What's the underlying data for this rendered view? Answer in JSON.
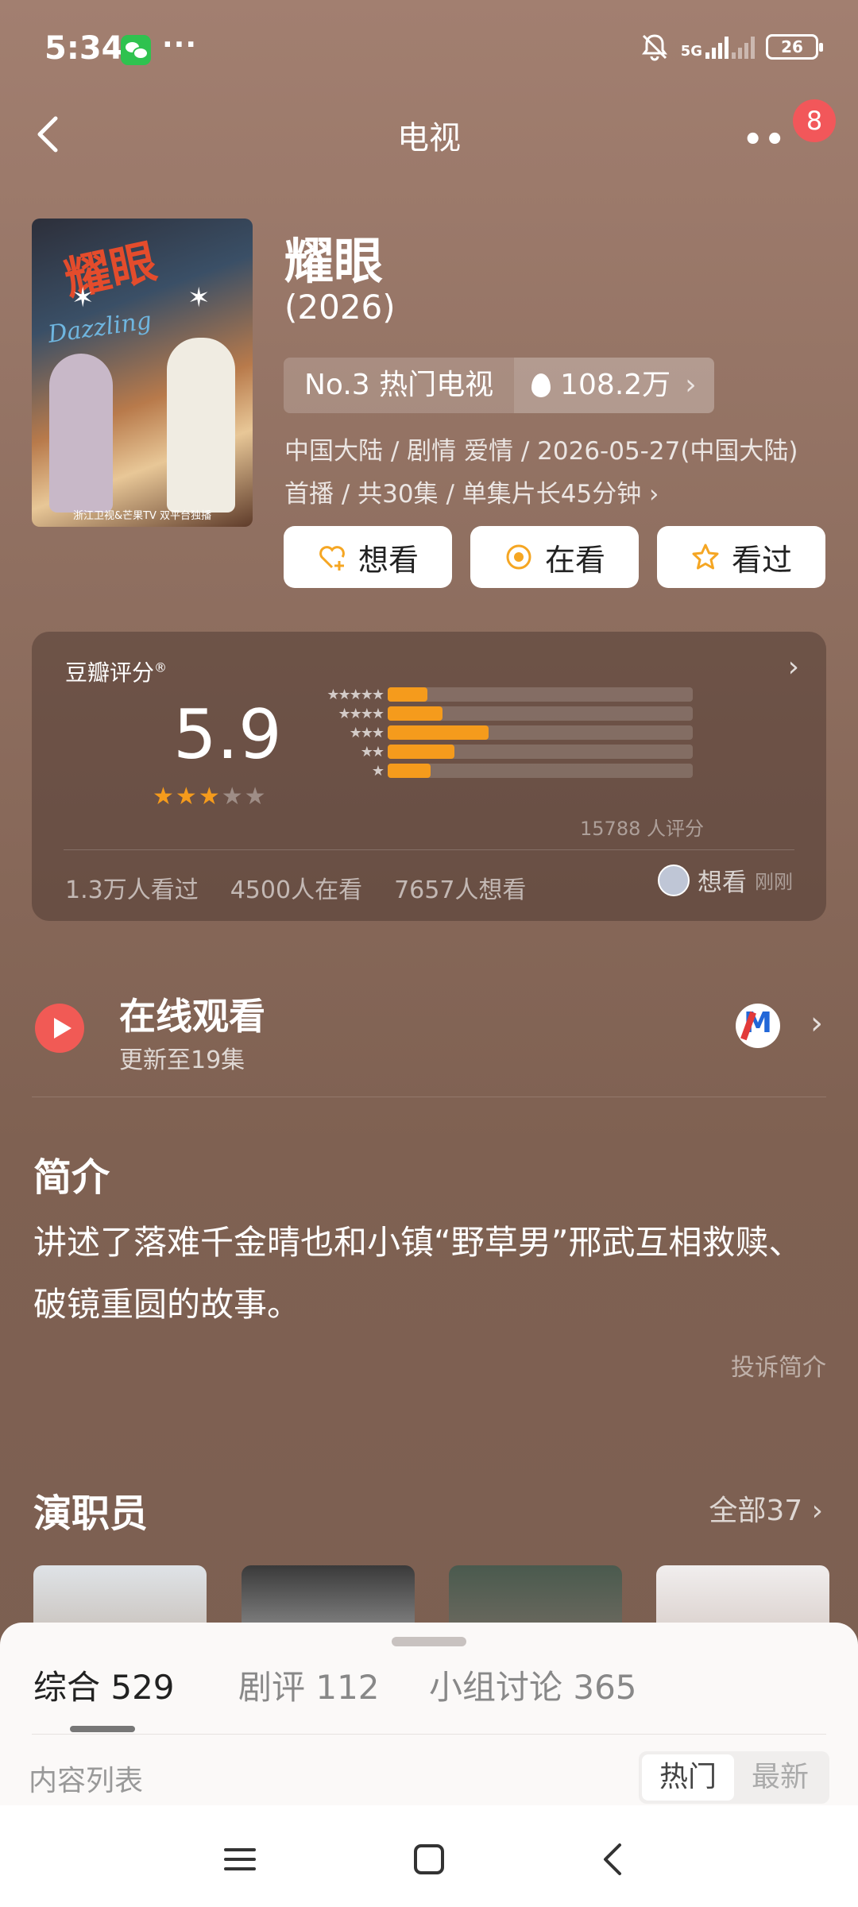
{
  "status_bar": {
    "time": "5:34",
    "more": "···",
    "network": "5G",
    "battery": "26",
    "icons": [
      "wechat-icon",
      "mute-bell-icon",
      "signal-icon",
      "battery-icon"
    ]
  },
  "header": {
    "title": "电视",
    "notification_count": "8"
  },
  "movie": {
    "poster_title": "耀眼",
    "poster_subtitle": "Dazzling",
    "poster_footer": "浙江卫视&芒果TV 双平台独播",
    "title": "耀眼",
    "year": "(2026)",
    "rank": "No.3 热门电视",
    "heat": "108.2万",
    "meta_line1": "中国大陆 / 剧情 爱情 / 2026-05-27(中国大陆)",
    "meta_line2": "首播 / 共30集 / 单集片长45分钟 ›"
  },
  "actions": {
    "want": "想看",
    "watching": "在看",
    "watched": "看过"
  },
  "rating": {
    "label": "豆瓣评分",
    "score": "5.9",
    "stars": 3,
    "distribution_percent": [
      13,
      18,
      33,
      22,
      14
    ],
    "count": "15788 人评分",
    "watched_stat": "1.3万人看过",
    "watching_stat": "4500人在看",
    "want_stat": "7657人想看",
    "recent_action": "想看",
    "recent_time": "刚刚"
  },
  "online": {
    "title": "在线观看",
    "subtitle": "更新至19集"
  },
  "synopsis": {
    "title": "简介",
    "text": "讲述了落难千金晴也和小镇“野草男”邢武互相救赎、破镜重圆的故事。",
    "report": "投诉简介"
  },
  "cast": {
    "title": "演职员",
    "all_link": "全部37 ›"
  },
  "sheet": {
    "tabs": [
      "综合 529",
      "剧评 112",
      "小组讨论 365"
    ],
    "list_label": "内容列表",
    "sort_hot": "热门",
    "sort_new": "最新"
  },
  "colors": {
    "accent": "#f59b1c",
    "badge": "#f2575a",
    "play": "#f15a55"
  }
}
